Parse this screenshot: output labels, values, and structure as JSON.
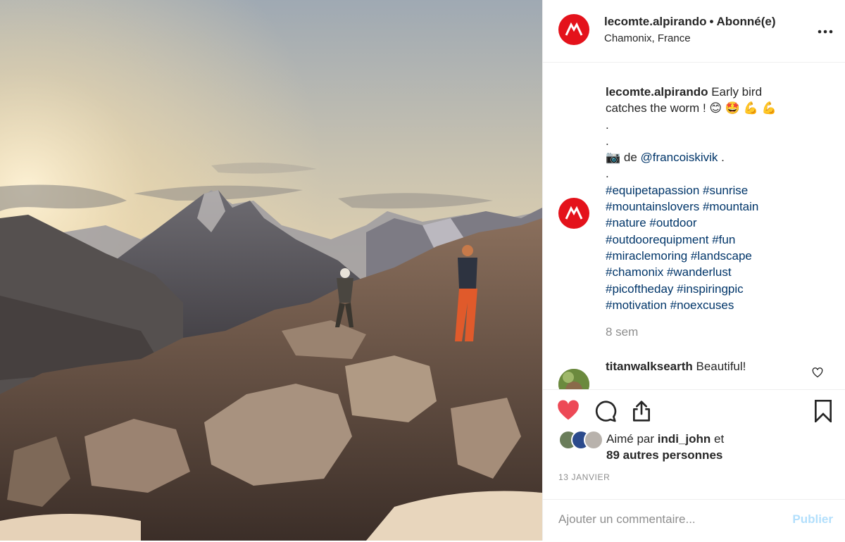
{
  "post": {
    "image_alt": "Two climbers on rocky ridge at sunrise with mountain range",
    "username": "lecomte.alpirando",
    "separator": "•",
    "follow_status": "Abonné(e)",
    "location": "Chamonix, France",
    "more_icon": "more-icon"
  },
  "caption": {
    "username": "lecomte.alpirando",
    "lines": [
      "Early bird",
      "catches the worm ! 😊 🤩 💪 💪",
      ".",
      ".",
      "📷  de ",
      ".",
      "#equipetapassion #sunrise",
      "#mountainslovers #mountain",
      "#nature #outdoor",
      "#outdoorequipment #fun",
      "#miraclemoring #landscape",
      "#chamonix #wanderlust",
      "#picoftheday #inspiringpic",
      "#motivation #noexcuses"
    ],
    "mention": "@francoiskivik",
    "mention_suffix": " .",
    "time_ago": "8 sem"
  },
  "comments": [
    {
      "username": "titanwalksearth",
      "text": "Beautiful!"
    }
  ],
  "actions": {
    "like_icon": "heart-filled-icon",
    "comment_icon": "comment-icon",
    "share_icon": "share-icon",
    "save_icon": "bookmark-icon"
  },
  "likes": {
    "prefix": "Aimé par ",
    "user": "indi_john",
    "middle": " et",
    "others": "89 autres personnes"
  },
  "date": "13 JANVIER",
  "add_comment": {
    "placeholder": "Ajouter un commentaire...",
    "publish_label": "Publier"
  },
  "colors": {
    "brand_red": "#e4121b",
    "like_red": "#ed4956",
    "link_blue": "#003569",
    "publish_disabled": "#b2dffc"
  }
}
